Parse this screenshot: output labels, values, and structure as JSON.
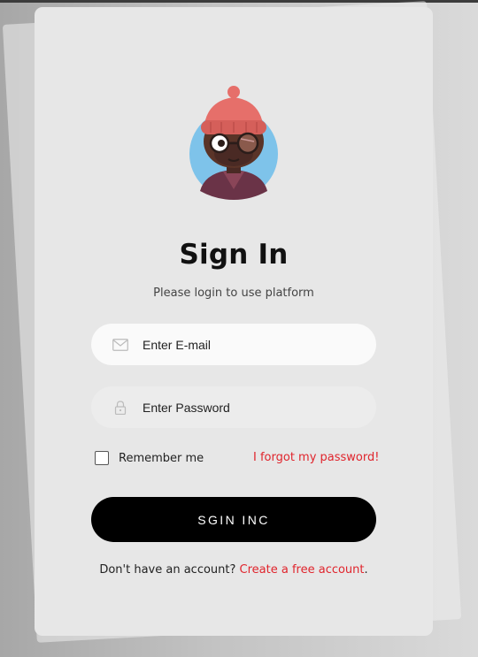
{
  "card": {
    "title": "Sign In",
    "subtitle": "Please login to use platform"
  },
  "email": {
    "placeholder": "Enter E-mail",
    "icon": "envelope-icon"
  },
  "password": {
    "placeholder": "Enter Password",
    "icon": "lock-icon"
  },
  "remember": {
    "label": "Remember me",
    "checked": false
  },
  "forgot": {
    "label": "I forgot my password!"
  },
  "submit": {
    "label": "SGIN INC"
  },
  "footer": {
    "prefix": "Don't have an account?",
    "link": "Create a free account",
    "suffix": "."
  },
  "colors": {
    "accent": "#e0242c",
    "button": "#000000",
    "card": "#e7e7e7",
    "avatar_bg": "#7ec3ea",
    "beanie": "#e66f6a"
  }
}
